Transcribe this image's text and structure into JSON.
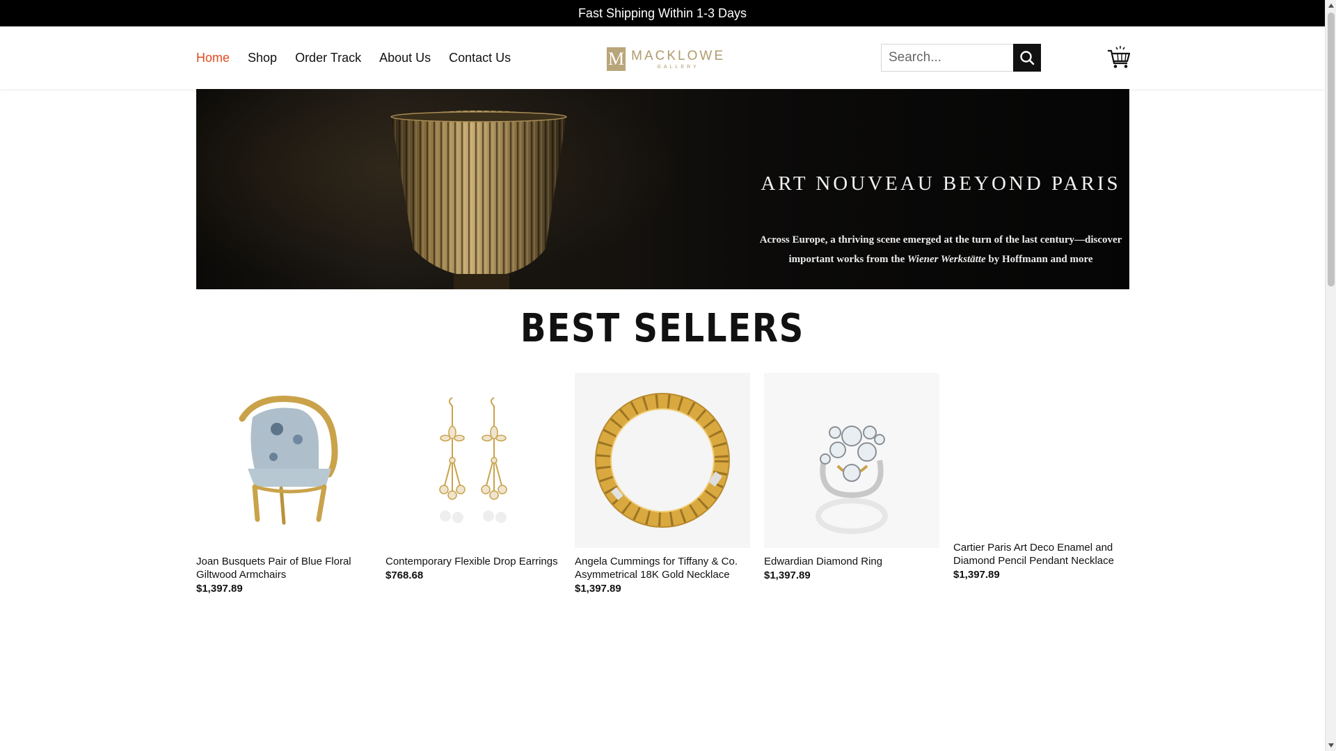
{
  "announcement": "Fast Shipping Within 1-3 Days",
  "nav": {
    "items": [
      {
        "label": "Home",
        "active": true
      },
      {
        "label": "Shop",
        "active": false
      },
      {
        "label": "Order Track",
        "active": false
      },
      {
        "label": "About Us",
        "active": false
      },
      {
        "label": "Contact Us",
        "active": false
      }
    ]
  },
  "logo": {
    "mark": "M",
    "name": "MACKLOWE",
    "sub": "GALLERY"
  },
  "search": {
    "placeholder": "Search...",
    "value": ""
  },
  "cart": {
    "icon": "cart-icon"
  },
  "banner": {
    "title": "ART NOUVEAU BEYOND PARIS",
    "text_before": "Across Europe, a thriving scene emerged at the turn of the last century—discover important works from the ",
    "text_italic": "Wiener Werkstätte",
    "text_after": " by Hoffmann and more"
  },
  "section": {
    "title": "BEST SELLERS"
  },
  "products": [
    {
      "name": "Joan Busquets Pair of Blue Floral Giltwood Armchairs",
      "price": "$1,397.89"
    },
    {
      "name": "Contemporary Flexible Drop Earrings",
      "price": "$768.68"
    },
    {
      "name": "Angela Cummings for Tiffany & Co. Asymmetrical 18K Gold Necklace",
      "price": "$1,397.89"
    },
    {
      "name": "Edwardian Diamond Ring",
      "price": "$1,397.89"
    },
    {
      "name": "Cartier Paris Art Deco Enamel and Diamond Pencil Pendant Necklace",
      "price": "$1,397.89"
    }
  ],
  "colors": {
    "accent": "#e04a1f",
    "topbar": "#000000",
    "gold": "#b09a6b"
  }
}
